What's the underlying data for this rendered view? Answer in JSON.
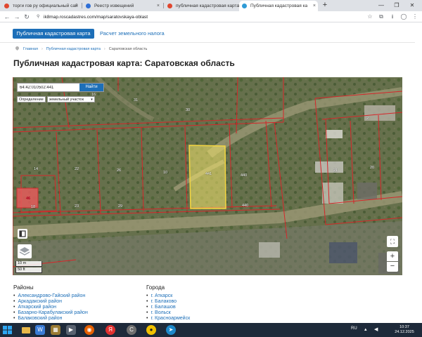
{
  "browser": {
    "tabs": [
      {
        "label": "торги гов ру официальный сай",
        "color": "#e0472f",
        "active": false
      },
      {
        "label": "Реестр извещений",
        "color": "#2f6fd6",
        "active": false
      },
      {
        "label": "публичная кадастровая карта",
        "color": "#e0472f",
        "active": false
      },
      {
        "label": "Публичная кадастровая ка",
        "color": "#2f9bd6",
        "active": true
      }
    ],
    "url": "ik8map.roscadastres.com/map/saratovskaya-oblast"
  },
  "site": {
    "primary_button": "Публичная кадастровая карта",
    "secondary_link": "Расчет земельного налога"
  },
  "breadcrumb": {
    "home": "Главная",
    "section": "Публичная кадастровая карта",
    "current": "Саратовская область"
  },
  "page_title": "Публичная кадастровая карта: Саратовская область",
  "map": {
    "search_value": "64:42:010502:441",
    "search_button": "Найти",
    "mode_label": "Определение",
    "mode_value": "земельный участок",
    "scale_top": "10 m",
    "scale_bottom": "50 ft",
    "parcel_numbers": {
      "p16": "16",
      "p31": "31",
      "p30": "30",
      "p14": "14",
      "p22": "22",
      "p26": "26",
      "p10": "10",
      "p441": "441",
      "p440": "440",
      "p440b": "440",
      "p23": "23",
      "p29": "29",
      "p18": "18",
      "p46": "46",
      "p21": "21",
      "p20": "20",
      "p2": "2"
    },
    "highlight_color": "#f2e36b",
    "boundary_color": "#d7262a"
  },
  "districts": {
    "title": "Районы",
    "items": [
      "Александрово-Гайский район",
      "Аркадакский район",
      "Аткарский район",
      "Базарно-Карабулакский район",
      "Балаковский район"
    ]
  },
  "cities": {
    "title": "Города",
    "items": [
      "г. Аткарск",
      "г. Балаково",
      "г. Балашов",
      "г. Вольск",
      "г. Красноармейск"
    ]
  },
  "taskbar": {
    "lang": "RU",
    "time": "10:37",
    "date": "24.12.2025"
  }
}
